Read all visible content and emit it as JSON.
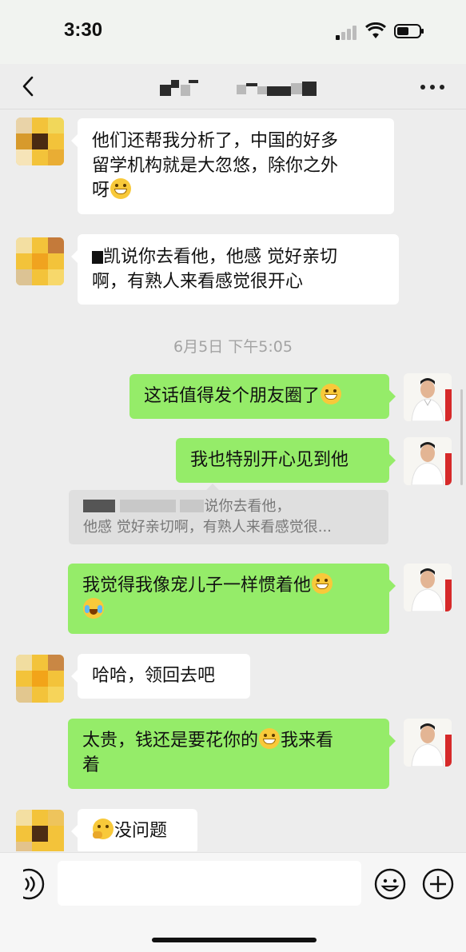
{
  "status": {
    "time": "3:30"
  },
  "header": {
    "title": ""
  },
  "messages": [
    {
      "side": "in",
      "lines": [
        "他们还帮我分析了，中国的好多",
        "留学机构就是大忽悠，除你之外",
        "呀"
      ],
      "emoji_end": "grin-icon"
    },
    {
      "side": "in",
      "lines": [
        "凯说你去看他，他感 觉好亲切",
        "啊，有熟人来看感觉很开心"
      ]
    },
    {
      "side": "out",
      "text": "这话值得发个朋友圈了"
    },
    {
      "side": "out",
      "text": "我也特别开心见到他"
    },
    {
      "side": "out",
      "lines": [
        "我觉得我像宠儿子一样惯着他"
      ]
    },
    {
      "side": "in",
      "text": "哈哈，领回去吧"
    },
    {
      "side": "out",
      "lines": [
        "太贵，钱还是要花你的",
        "我来看",
        "着"
      ]
    },
    {
      "side": "in",
      "text": "没问题"
    }
  ],
  "timestamp": "6月5日 下午5:05",
  "quote": {
    "line1_suffix": "说你去看他，",
    "line2": "他感 觉好亲切啊，有熟人来看感觉很..."
  },
  "input": {
    "value": "",
    "placeholder": ""
  },
  "colors": {
    "out_bubble": "#95ec69",
    "in_bubble": "#ffffff",
    "background": "#ededed"
  }
}
